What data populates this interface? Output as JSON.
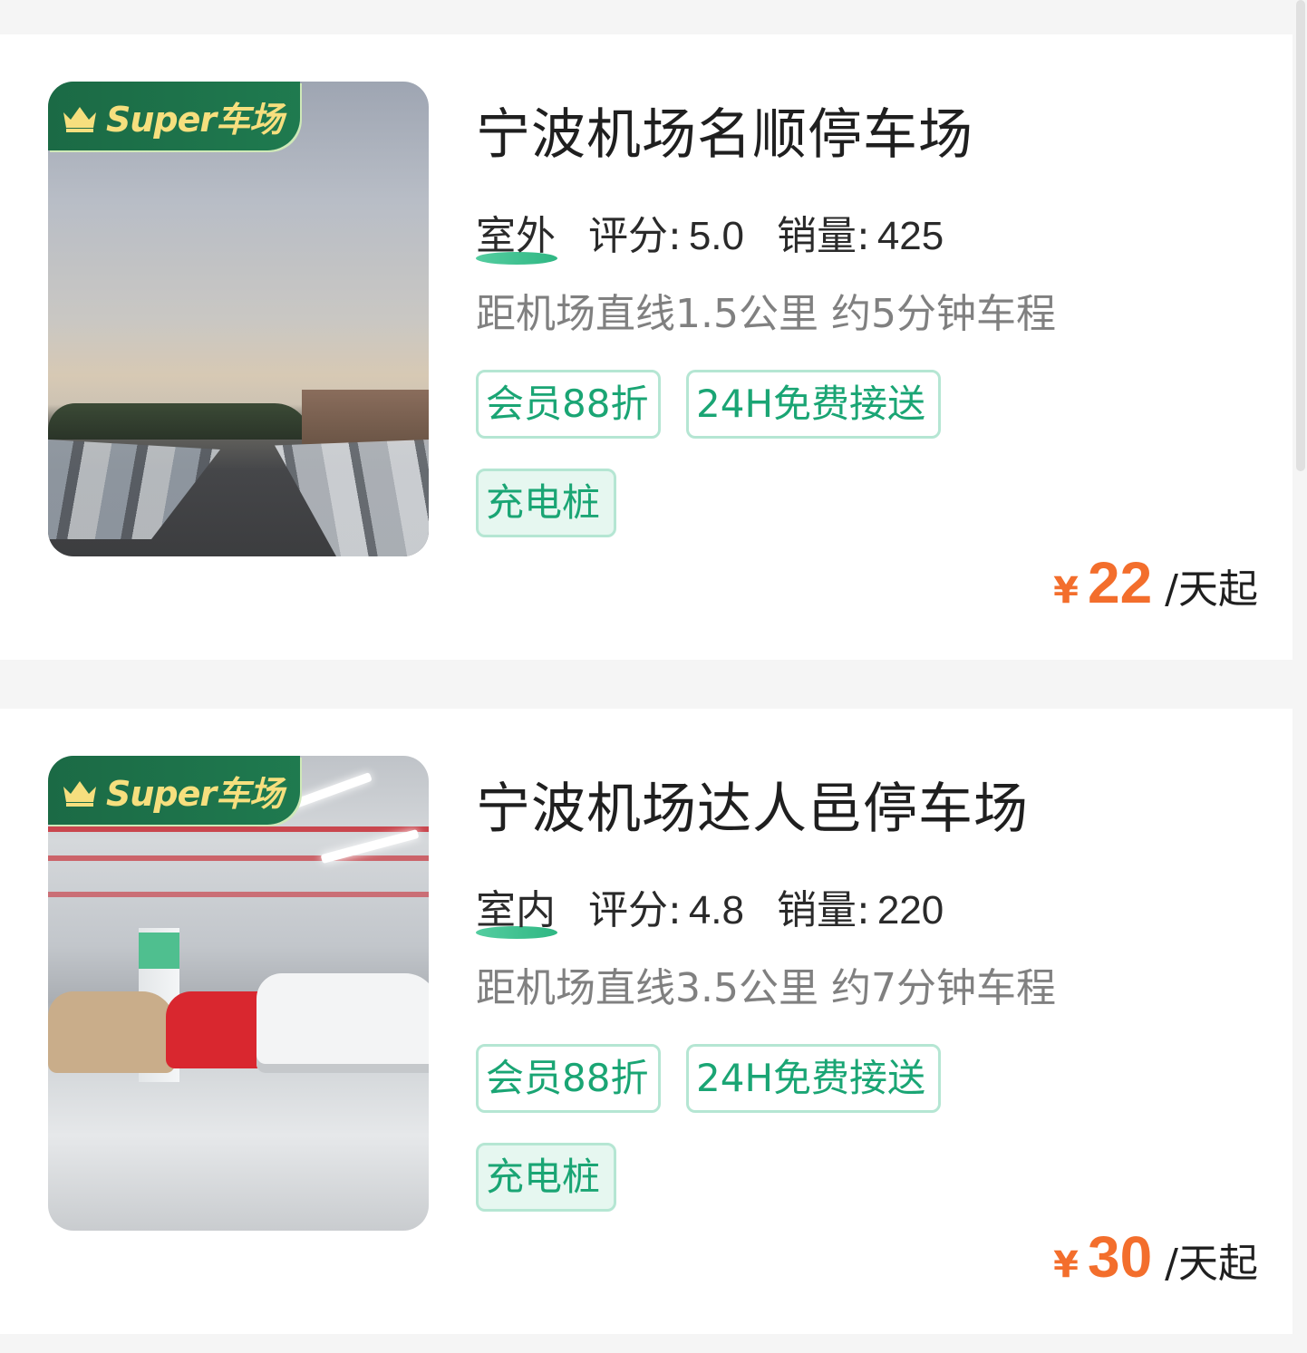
{
  "badge_text": "Super车场",
  "currency_symbol": "¥",
  "listings": [
    {
      "name": "宁波机场名顺停车场",
      "environment": "室外",
      "score_label": "评分:",
      "score": "5.0",
      "sales_label": "销量:",
      "sales": "425",
      "distance": "距机场直线1.5公里 约5分钟车程",
      "tags": [
        "会员88折",
        "24H免费接送",
        "充电桩"
      ],
      "price": "22",
      "price_unit": "/天起"
    },
    {
      "name": "宁波机场达人邑停车场",
      "environment": "室内",
      "score_label": "评分:",
      "score": "4.8",
      "sales_label": "销量:",
      "sales": "220",
      "distance": "距机场直线3.5公里 约7分钟车程",
      "tags": [
        "会员88折",
        "24H免费接送",
        "充电桩"
      ],
      "price": "30",
      "price_unit": "/天起"
    }
  ],
  "colors": {
    "accent_green": "#1aa574",
    "price_orange": "#f36e2c",
    "badge_green": "#1f7a4f",
    "badge_gold": "#f6df7e"
  }
}
